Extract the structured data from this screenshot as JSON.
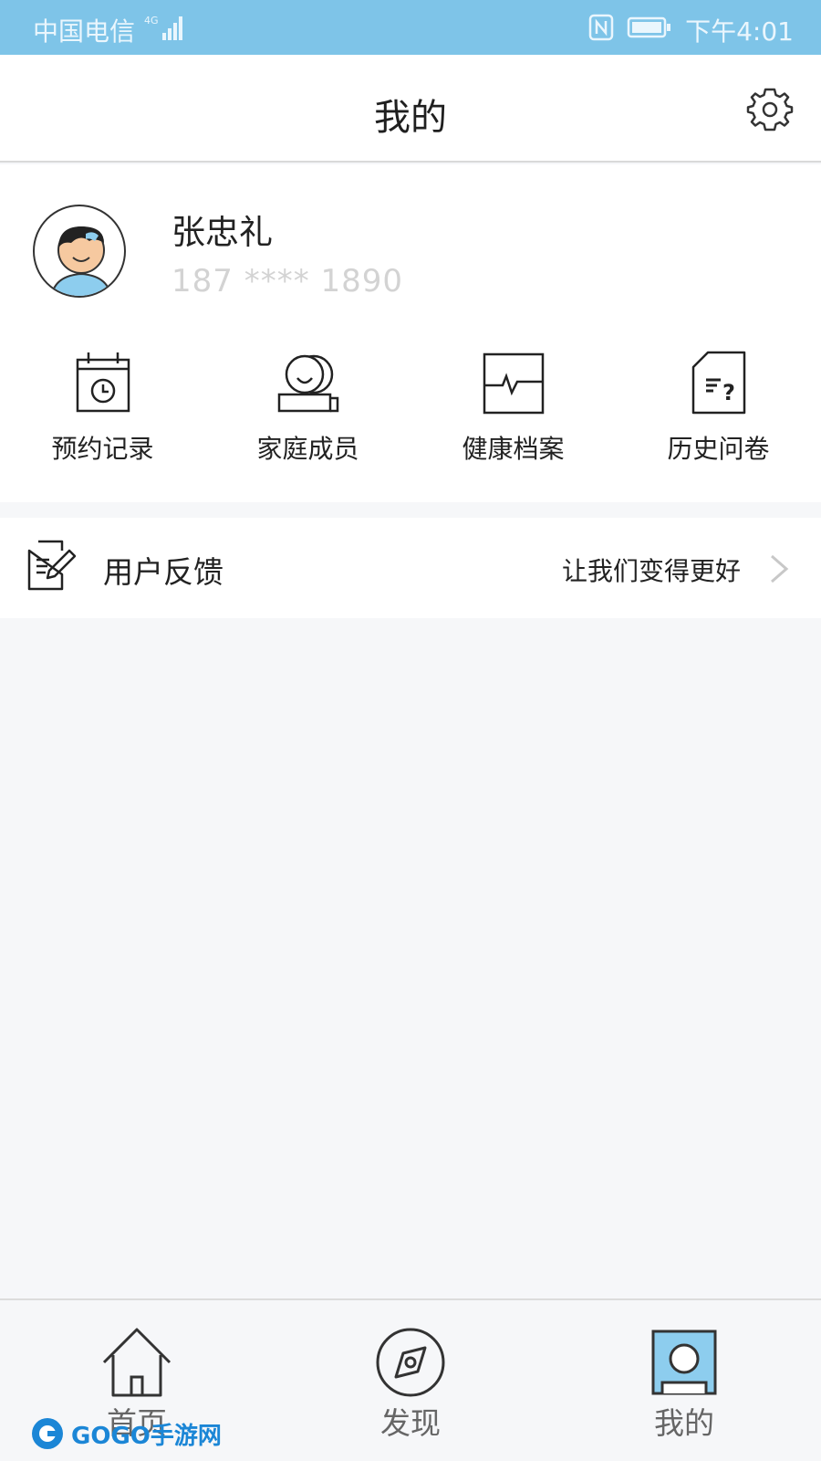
{
  "status_bar": {
    "carrier": "中国电信",
    "network": "4G",
    "time": "下午4:01"
  },
  "header": {
    "title": "我的"
  },
  "profile": {
    "name": "张忠礼",
    "phone": "187 **** 1890"
  },
  "quick_actions": [
    {
      "label": "预约记录",
      "icon": "calendar-clock-icon"
    },
    {
      "label": "家庭成员",
      "icon": "family-members-icon"
    },
    {
      "label": "健康档案",
      "icon": "heartbeat-icon"
    },
    {
      "label": "历史问卷",
      "icon": "questionnaire-icon"
    }
  ],
  "feedback": {
    "label": "用户反馈",
    "hint": "让我们变得更好"
  },
  "tab_bar": {
    "tabs": [
      {
        "label": "首页",
        "icon": "home-icon",
        "active": false
      },
      {
        "label": "发现",
        "icon": "compass-icon",
        "active": false
      },
      {
        "label": "我的",
        "icon": "profile-icon",
        "active": true
      }
    ]
  },
  "watermark": {
    "text": "GOGO手游网"
  },
  "colors": {
    "status_bar": "#7ec4e8",
    "accent": "#8dcdee",
    "background": "#f6f7f9"
  }
}
